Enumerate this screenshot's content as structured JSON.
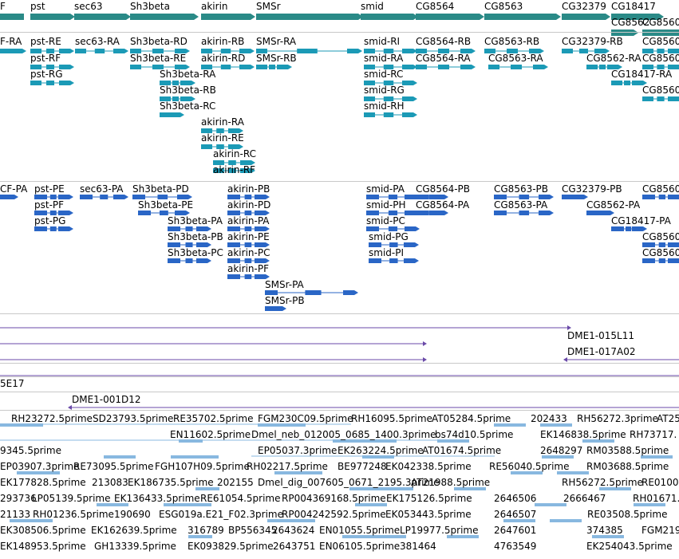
{
  "colors": {
    "gene": "#2a8a87",
    "rna": "#1b9ab6",
    "protein": "#2a66c6",
    "clone": "#6a4aa8",
    "est": "#88b8e0",
    "separator": "#c8c8c8"
  },
  "gene_track": [
    {
      "label": "F"
    },
    {
      "label": "pst"
    },
    {
      "label": "sec63"
    },
    {
      "label": "Sh3beta"
    },
    {
      "label": "akirin"
    },
    {
      "label": "SMSr"
    },
    {
      "label": "smid"
    },
    {
      "label": "CG8564"
    },
    {
      "label": "CG8563"
    },
    {
      "label": "CG32379"
    },
    {
      "label": "CG18417"
    },
    {
      "label": "CG8562"
    },
    {
      "label": "CG8560"
    }
  ],
  "rna_track": [
    {
      "label": "F-RA"
    },
    {
      "label": "pst-RE"
    },
    {
      "label": "pst-RF"
    },
    {
      "label": "pst-RG"
    },
    {
      "label": "sec63-RA"
    },
    {
      "label": "Sh3beta-RD"
    },
    {
      "label": "Sh3beta-RE"
    },
    {
      "label": "Sh3beta-RA"
    },
    {
      "label": "Sh3beta-RB"
    },
    {
      "label": "Sh3beta-RC"
    },
    {
      "label": "akirin-RB"
    },
    {
      "label": "akirin-RD"
    },
    {
      "label": "akirin-RA"
    },
    {
      "label": "akirin-RE"
    },
    {
      "label": "akirin-RC"
    },
    {
      "label": "akirin-RF"
    },
    {
      "label": "SMSr-RA"
    },
    {
      "label": "SMSr-RB"
    },
    {
      "label": "smid-RI"
    },
    {
      "label": "smid-RA"
    },
    {
      "label": "smid-RC"
    },
    {
      "label": "smid-RG"
    },
    {
      "label": "smid-RH"
    },
    {
      "label": "CG8564-RB"
    },
    {
      "label": "CG8564-RA"
    },
    {
      "label": "CG8563-RB"
    },
    {
      "label": "CG8563-RA"
    },
    {
      "label": "CG32379-RB"
    },
    {
      "label": "CG8562-RA"
    },
    {
      "label": "CG18417-RA"
    },
    {
      "label": "CG8560"
    },
    {
      "label": "CG8560"
    },
    {
      "label": "CG8560"
    }
  ],
  "protein_track": [
    {
      "label": "CF-PA"
    },
    {
      "label": "pst-PE"
    },
    {
      "label": "pst-PF"
    },
    {
      "label": "pst-PG"
    },
    {
      "label": "sec63-PA"
    },
    {
      "label": "Sh3beta-PD"
    },
    {
      "label": "Sh3beta-PE"
    },
    {
      "label": "Sh3beta-PA"
    },
    {
      "label": "Sh3beta-PB"
    },
    {
      "label": "Sh3beta-PC"
    },
    {
      "label": "akirin-PB"
    },
    {
      "label": "akirin-PD"
    },
    {
      "label": "akirin-PA"
    },
    {
      "label": "akirin-PE"
    },
    {
      "label": "akirin-PC"
    },
    {
      "label": "akirin-PF"
    },
    {
      "label": "SMSr-PA"
    },
    {
      "label": "SMSr-PB"
    },
    {
      "label": "smid-PA"
    },
    {
      "label": "smid-PH"
    },
    {
      "label": "smid-PC"
    },
    {
      "label": "smid-PG"
    },
    {
      "label": "smid-PI"
    },
    {
      "label": "CG8564-PB"
    },
    {
      "label": "CG8564-PA"
    },
    {
      "label": "CG8563-PB"
    },
    {
      "label": "CG8563-PA"
    },
    {
      "label": "CG32379-PB"
    },
    {
      "label": "CG8562-PA"
    },
    {
      "label": "CG18417-PA"
    },
    {
      "label": "CG8560"
    },
    {
      "label": "CG8560"
    },
    {
      "label": "CG8560"
    }
  ],
  "clone_track": [
    {
      "label": "DME1-015L11"
    },
    {
      "label": "DME1-017A02"
    },
    {
      "label": "5E17"
    },
    {
      "label": "DME1-001D12"
    }
  ],
  "est_track": [
    {
      "label": "RH23272.5prime"
    },
    {
      "label": "SD23793.5prime"
    },
    {
      "label": "RE35702.5prime"
    },
    {
      "label": "FGM230C09.5prime"
    },
    {
      "label": "RH16095.5prime"
    },
    {
      "label": "AT05284.5prime"
    },
    {
      "label": "202433"
    },
    {
      "label": "RH56272.3prime"
    },
    {
      "label": "AT25"
    },
    {
      "label": "EN11602.5prime"
    },
    {
      "label": "Dmel_neb_012005_0685_1400.3prime"
    },
    {
      "label": "bs74d10.5prime"
    },
    {
      "label": "EK146838.5prime"
    },
    {
      "label": "RH73717."
    },
    {
      "label": "9345.5prime"
    },
    {
      "label": "EP05037.3prime"
    },
    {
      "label": "EK263224.5prime"
    },
    {
      "label": "AT01674.5prime"
    },
    {
      "label": "2648297"
    },
    {
      "label": "RM03588.5prime"
    },
    {
      "label": "EP03907.3prime"
    },
    {
      "label": "RE73095.5prime"
    },
    {
      "label": "FGH107H09.5prime"
    },
    {
      "label": "RH02217.5prime"
    },
    {
      "label": "BE977248"
    },
    {
      "label": "EK042338.5prime"
    },
    {
      "label": "RE56040.5prime"
    },
    {
      "label": "RM03688.5prime"
    },
    {
      "label": "EK177828.5prime"
    },
    {
      "label": "213083"
    },
    {
      "label": "EK186735.5prime"
    },
    {
      "label": "202155"
    },
    {
      "label": "Dmel_dig_007605_0671_2195.3prime"
    },
    {
      "label": "AT21988.5prime"
    },
    {
      "label": "RH56272.5prime"
    },
    {
      "label": "RE0100"
    },
    {
      "label": "293736"
    },
    {
      "label": "LP05139.5prime"
    },
    {
      "label": "EK136433.5prime"
    },
    {
      "label": "RE61054.5prime"
    },
    {
      "label": "RP004369168.5prime"
    },
    {
      "label": "EK175126.5prime"
    },
    {
      "label": "2646506"
    },
    {
      "label": "2666467"
    },
    {
      "label": "RH01671."
    },
    {
      "label": "21133"
    },
    {
      "label": "RH01236.5prime"
    },
    {
      "label": "190690"
    },
    {
      "label": "ESG019a.E21_F02.3prime"
    },
    {
      "label": "RP004242592.5prime"
    },
    {
      "label": "EK053443.5prime"
    },
    {
      "label": "2646507"
    },
    {
      "label": "RE03508.5prime"
    },
    {
      "label": "EK308506.5prime"
    },
    {
      "label": "EK162639.5prime"
    },
    {
      "label": "316789"
    },
    {
      "label": "BP556345"
    },
    {
      "label": "2643624"
    },
    {
      "label": "EN01055.5prime"
    },
    {
      "label": "LP19977.5prime"
    },
    {
      "label": "2647601"
    },
    {
      "label": "374385"
    },
    {
      "label": "FGM219"
    },
    {
      "label": "EK148953.5prime"
    },
    {
      "label": "GH13339.5prime"
    },
    {
      "label": "EK093829.5prime"
    },
    {
      "label": "2643751"
    },
    {
      "label": "EN06105.5prime"
    },
    {
      "label": "381464"
    },
    {
      "label": "4763549"
    },
    {
      "label": "EK254043.5prime"
    }
  ]
}
